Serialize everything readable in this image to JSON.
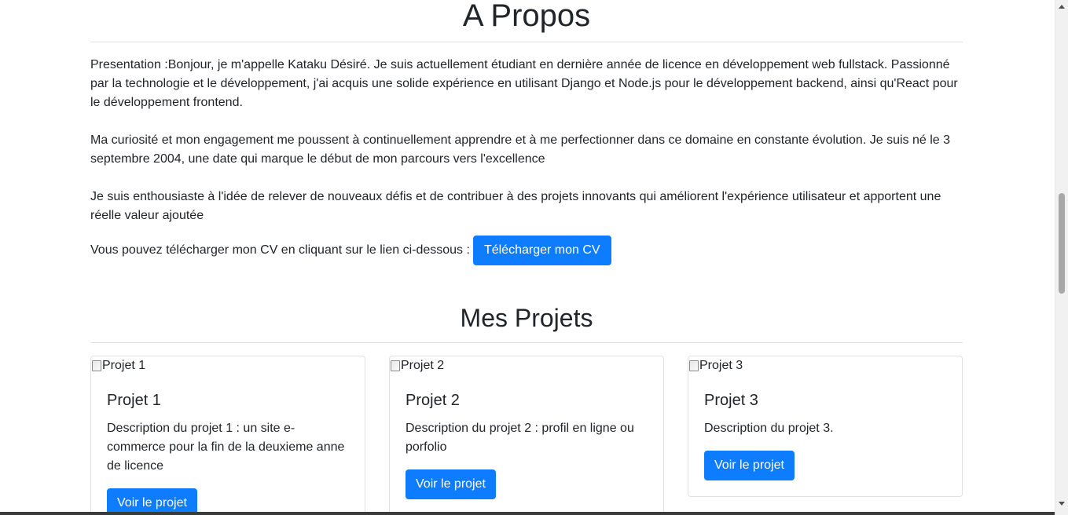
{
  "about": {
    "title": "A Propos",
    "paragraphs": [
      "Presentation :Bonjour, je m'appelle Kataku Désiré. Je suis actuellement étudiant en dernière année de licence en développement web fullstack. Passionné par la technologie et le développement, j'ai acquis une solide expérience en utilisant Django et Node.js pour le développement backend, ainsi qu'React pour le développement frontend.",
      "Ma curiosité et mon engagement me poussent à continuellement apprendre et à me perfectionner dans ce domaine en constante évolution. Je suis né le 3 septembre 2004, une date qui marque le début de mon parcours vers l'excellence",
      "Je suis enthousiaste à l'idée de relever de nouveaux défis et de contribuer à des projets innovants qui améliorent l'expérience utilisateur et apportent une réelle valeur ajoutée"
    ],
    "cv_text": "Vous pouvez télécharger mon CV en cliquant sur le lien ci-dessous :",
    "cv_button": "Télécharger mon CV"
  },
  "projects": {
    "title": "Mes Projets",
    "items": [
      {
        "img_alt": "Projet 1",
        "title": "Projet 1",
        "description": "Description du projet 1 : un site e-commerce pour la fin de la deuxieme anne de licence",
        "button": "Voir le projet"
      },
      {
        "img_alt": "Projet 2",
        "title": "Projet 2",
        "description": "Description du projet 2 : profil en ligne ou porfolio",
        "button": "Voir le projet"
      },
      {
        "img_alt": "Projet 3",
        "title": "Projet 3",
        "description": "Description du projet 3.",
        "button": "Voir le projet"
      }
    ]
  },
  "colors": {
    "primary_button": "#0d7cff",
    "text": "#212529",
    "rule": "#dee2e6"
  },
  "icons": {
    "card_image": "broken-image-icon"
  }
}
